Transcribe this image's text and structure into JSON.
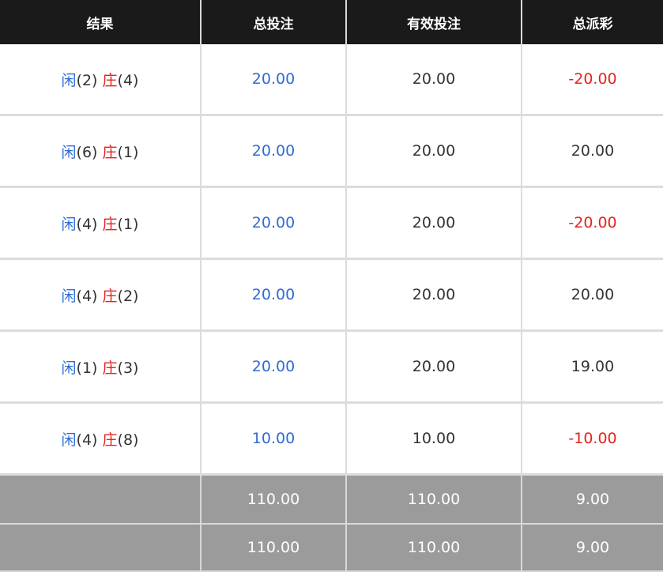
{
  "colors": {
    "header_bg": "#1a1a1a",
    "footer_bg": "#9b9b9b",
    "player": "#2f6bd6",
    "banker": "#e0241f",
    "text": "#333333"
  },
  "table": {
    "headers": {
      "result": "结果",
      "total_bet": "总投注",
      "valid_bet": "有效投注",
      "total_payout": "总派彩"
    },
    "rows": [
      {
        "player_label": "闲",
        "player_score": "(2)",
        "banker_label": "庄",
        "banker_score": "(4)",
        "total_bet": "20.00",
        "valid_bet": "20.00",
        "payout": "-20.00",
        "payout_tone": "red"
      },
      {
        "player_label": "闲",
        "player_score": "(6)",
        "banker_label": "庄",
        "banker_score": "(1)",
        "total_bet": "20.00",
        "valid_bet": "20.00",
        "payout": "20.00",
        "payout_tone": "dark"
      },
      {
        "player_label": "闲",
        "player_score": "(4)",
        "banker_label": "庄",
        "banker_score": "(1)",
        "total_bet": "20.00",
        "valid_bet": "20.00",
        "payout": "-20.00",
        "payout_tone": "red"
      },
      {
        "player_label": "闲",
        "player_score": "(4)",
        "banker_label": "庄",
        "banker_score": "(2)",
        "total_bet": "20.00",
        "valid_bet": "20.00",
        "payout": "20.00",
        "payout_tone": "dark"
      },
      {
        "player_label": "闲",
        "player_score": "(1)",
        "banker_label": "庄",
        "banker_score": "(3)",
        "total_bet": "20.00",
        "valid_bet": "20.00",
        "payout": "19.00",
        "payout_tone": "dark"
      },
      {
        "player_label": "闲",
        "player_score": "(4)",
        "banker_label": "庄",
        "banker_score": "(8)",
        "total_bet": "10.00",
        "valid_bet": "10.00",
        "payout": "-10.00",
        "payout_tone": "red"
      }
    ],
    "totals": [
      {
        "total_bet": "110.00",
        "valid_bet": "110.00",
        "payout": "9.00"
      },
      {
        "total_bet": "110.00",
        "valid_bet": "110.00",
        "payout": "9.00"
      }
    ]
  }
}
